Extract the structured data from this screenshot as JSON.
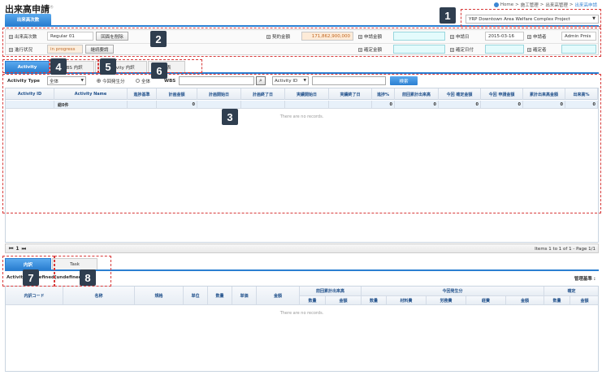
{
  "header": {
    "title": "出来高申請",
    "title_mark": "®",
    "breadcrumb": [
      "Home",
      "施工管理",
      "出来高管理",
      "出来高申請"
    ],
    "breadcrumb_sep": ">",
    "top_tab": "出来高次数",
    "project": "YRP Downtown Area Welfare Complex Project"
  },
  "form": {
    "row1": {
      "lbl_count": "出来高次数",
      "count_value": "Regular 01",
      "btn_delete": "回面を削除",
      "lbl_contract": "契約金額",
      "contract_value": "171,862,900,000",
      "lbl_apply_amount": "申請金額",
      "lbl_apply_date": "申請日",
      "apply_date_value": "2015-03-16",
      "lbl_applicant": "申請者",
      "applicant_value": "Admin Pmis"
    },
    "row2": {
      "lbl_status": "進行状況",
      "status_value": "in progress",
      "btn_continue": "継続要請",
      "lbl_fixed_amount": "確定金額",
      "lbl_fixed_date": "確定日付",
      "lbl_fixer": "確定者"
    }
  },
  "tabs": {
    "activity": "Activity",
    "wbs": "WBS 内訳",
    "activity_detail": "Activity 内訳",
    "summary": "総表"
  },
  "filter": {
    "activity_type_label": "Activity Type",
    "activity_type_value": "全体",
    "radio_current": "今回発生分",
    "radio_all": "全体",
    "wbs_label": "WBS",
    "search_field_value": "Activity ID",
    "query_button": "検索"
  },
  "grid": {
    "columns": [
      "Activity ID",
      "Activity Name",
      "進捗基準",
      "計画金額",
      "計画開始日",
      "計画終了日",
      "実績開始日",
      "実績終了日",
      "進捗%",
      "前回累計出来高",
      "今回 確定金額",
      "今回 申請金額",
      "累計出来高金額",
      "出来高%"
    ],
    "summary_label": "総0件",
    "summary_values": [
      "0",
      "0",
      "0",
      "0",
      "0",
      "0",
      "0"
    ],
    "empty_text": "There are no records."
  },
  "pager": {
    "page": "1",
    "info": "Items 1 to 1 of 1 - Page 1/1"
  },
  "bottom": {
    "tab_detail": "内訳",
    "tab_task": "Task",
    "activity_info": "Activity: undefined[undefined]",
    "mgmt_label": "管理基準 :",
    "cols_single": [
      "内訳コード",
      "名称",
      "規格",
      "単位",
      "数量",
      "単価",
      "金額"
    ],
    "group_prev": "前回累計出来高",
    "group_current": "今回発生分",
    "group_fixed": "確定",
    "sub_prev": [
      "数量",
      "金額"
    ],
    "sub_current": [
      "数量",
      "材料費",
      "労務費",
      "経費",
      "金額"
    ],
    "sub_fixed": [
      "数量",
      "金額"
    ],
    "empty_text": "There are no records."
  },
  "annotations": [
    "1",
    "2",
    "3",
    "4",
    "5",
    "6",
    "7",
    "8"
  ]
}
